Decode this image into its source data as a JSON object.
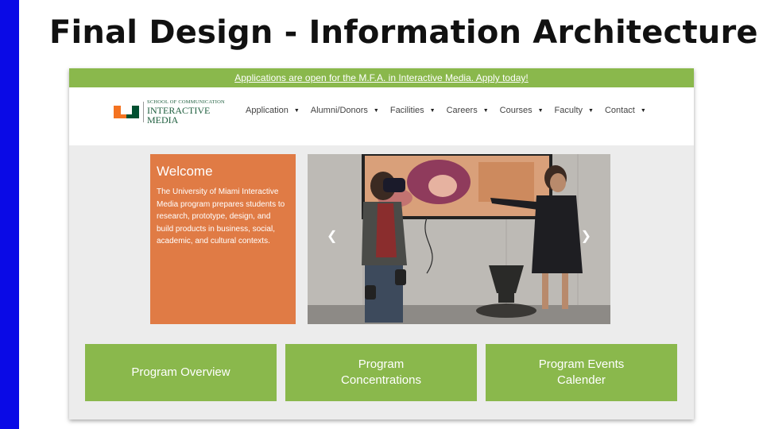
{
  "slide": {
    "title": "Final Design - Information Architecture"
  },
  "site": {
    "announcement": "Applications are open for the M.F.A. in Interactive Media. Apply today!",
    "logo": {
      "line1": "SCHOOL OF COMMUNICATION",
      "line2": "INTERACTIVE",
      "line3": "MEDIA",
      "mark_colors": [
        "#f47321",
        "#005030"
      ]
    },
    "nav": [
      {
        "label": "Application"
      },
      {
        "label": "Alumni/Donors"
      },
      {
        "label": "Facilities"
      },
      {
        "label": "Careers"
      },
      {
        "label": "Courses"
      },
      {
        "label": "Faculty"
      },
      {
        "label": "Contact"
      }
    ],
    "welcome": {
      "heading": "Welcome",
      "body": "The University of Miami Interactive Media program prepares students to research, prototype, design, and build products in business, social, academic, and cultural contexts."
    },
    "carousel": {
      "prev_icon": "chevron-left-icon",
      "next_icon": "chevron-right-icon"
    },
    "tiles": [
      {
        "line1": "Program Overview",
        "line2": ""
      },
      {
        "line1": "Program",
        "line2": "Concentrations"
      },
      {
        "line1": "Program Events",
        "line2": "Calender"
      }
    ]
  },
  "colors": {
    "accent_blue": "#0a0ae6",
    "green": "#8ab84c",
    "orange": "#e07b45"
  }
}
